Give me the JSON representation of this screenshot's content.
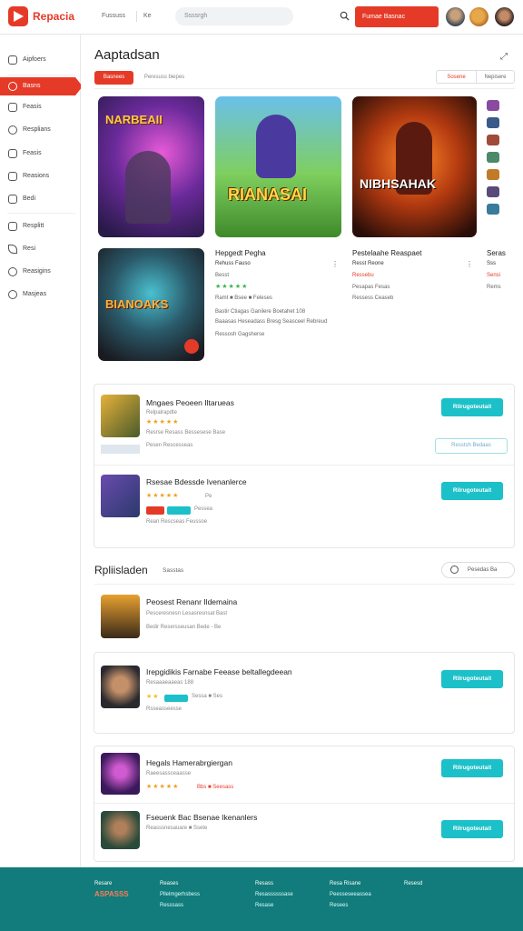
{
  "header": {
    "brand": "Repacia",
    "seg1": "Fussuss",
    "seg2": "Ke",
    "search_placeholder": "Ssssrgh",
    "cta": "Fumae Basnac"
  },
  "sidebar": {
    "items": [
      "Aipfoers",
      "Basns",
      "Feasis",
      "Resplians",
      "Feasis",
      "Reasions",
      "Bedi",
      "Resplitt",
      "Resi",
      "Reasigins",
      "Masjeas"
    ]
  },
  "main": {
    "title": "Aaptadsan",
    "tabs": [
      "Basnees",
      "Peresuss biepes"
    ],
    "actions": [
      "Sosene",
      "Nepisere"
    ],
    "featured": [
      {
        "art": "NARBEAII",
        "title": "Hepgedt Pegha",
        "sub": "Rehuss Fauso",
        "meta": "Besst",
        "rating": "Ramt ■ Bsee ■ Feleses",
        "desc1": "Bastir Ctiagas Ganilere Boetahet 108",
        "desc2": "Baaasas Heseadass Bresg Seasceel Rebreud",
        "desc3": "Ressosh Gagsherse"
      },
      {
        "art": "RIANASAI",
        "title": "Pestelaahe Reaspaet",
        "sub": "Resst Reone",
        "meta": "Ressebu",
        "rating": "",
        "desc1": "Pesapas Fesas",
        "desc2": "Ressess Ceaseb",
        "desc3": ""
      },
      {
        "art": "NIBHSAHAK",
        "title": "Seras",
        "sub": "Sss",
        "meta": "Sensi",
        "rating": "",
        "desc1": "Rems",
        "desc2": "",
        "desc3": ""
      },
      {
        "art": "BIANOAKS",
        "title": "",
        "sub": "",
        "meta": "",
        "rating": "",
        "desc1": "",
        "desc2": "",
        "desc3": ""
      }
    ],
    "list1": [
      {
        "title": "Mngaes Peoeen Iltarueas",
        "sub": "Relpalrapdte",
        "meta": "Resrse Resass Bessesese Base",
        "meta2": "Pesen Rescesseas",
        "btn": "Rilrugoteutait",
        "btn2": "Resstsh Bedaas"
      },
      {
        "title": "Rsesae Bdessde Ivenanlerce",
        "sub": "Pe",
        "meta": "Pessea",
        "meta2": "Rean Rescseas Feussoe",
        "btn": "Rilrugoteutait"
      }
    ],
    "section2": {
      "title": "Rpliisladen",
      "sub": "Sasstas",
      "action": "Pesedas Ba"
    },
    "list2": [
      {
        "title": "Peosest Renanr Ildemaina",
        "sub": "Pesceresnesn Lesasresnsat Bast",
        "meta": "Bedir Resersseusan Bede - Be"
      },
      {
        "title": "Irepgidikis Farnabe Feease beltallegdeean",
        "sub": "Resaaaeaaeas 188",
        "meta": "Rsseasseesse",
        "btn": "Rilrugoteutait",
        "tag": "Sessa ■ Ses"
      },
      {
        "title": "Hegals Hamerabrgiergan",
        "sub": "Raeesassceaasse",
        "meta": "Bbs ■ Seesass",
        "btn": "Rilrugoteutait"
      },
      {
        "title": "Fseuenk Bac Bsenae Ikenanlers",
        "sub": "Reasssnesauare ■ Ssete",
        "btn": "Rilrugoteutait"
      }
    ]
  },
  "footer": {
    "cols": [
      {
        "head": "Resare",
        "lines": [
          "ASPASSS"
        ]
      },
      {
        "head": "Reases",
        "lines": [
          "Pllelmgerhsbess",
          "Resssass"
        ]
      },
      {
        "head": "Resass",
        "lines": [
          "Resassssssase",
          "Resase"
        ]
      },
      {
        "head": "Resa Risane",
        "lines": [
          "Peesseseeassea",
          "Resees"
        ]
      },
      {
        "head": "Resesd",
        "lines": []
      }
    ]
  },
  "colors": {
    "accent": "#e53a27",
    "teal": "#1cc0c8",
    "footer": "#117c7b"
  }
}
